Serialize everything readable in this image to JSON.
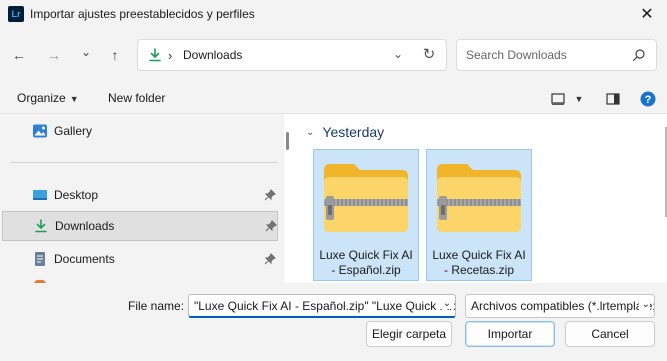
{
  "window": {
    "app_icon_text": "Lr",
    "title": "Importar ajustes preestablecidos y perfiles",
    "close_glyph": "✕"
  },
  "nav": {
    "back_glyph": "←",
    "forward_glyph": "→",
    "recent_glyph": "⌄",
    "up_glyph": "↑",
    "address_separator": "›",
    "address_location": "Downloads",
    "address_dropdown_glyph": "⌄",
    "refresh_glyph": "↻",
    "search_placeholder": "Search Downloads"
  },
  "toolbar": {
    "organize_label": "Organize",
    "organize_caret": "▼",
    "new_folder_label": "New folder"
  },
  "sidebar": {
    "items": [
      {
        "label": "Gallery",
        "icon": "gallery-icon"
      },
      {
        "label": "Desktop",
        "icon": "desktop-icon",
        "pinned": true
      },
      {
        "label": "Downloads",
        "icon": "download-icon",
        "pinned": true,
        "selected": true
      },
      {
        "label": "Documents",
        "icon": "documents-icon",
        "pinned": true
      }
    ]
  },
  "files": {
    "group_label": "Yesterday",
    "group_chevron": "⌄",
    "items": [
      {
        "name": "Luxe Quick Fix AI - Español.zip",
        "icon": "zip-folder-icon",
        "selected": true
      },
      {
        "name": "Luxe Quick Fix AI - Recetas.zip",
        "icon": "zip-folder-icon",
        "selected": true
      }
    ]
  },
  "bottom": {
    "file_name_label": "File name:",
    "file_name_value": "\"Luxe Quick Fix AI - Español.zip\" \"Luxe Quick Fix AI - Recetas.zip\"",
    "file_name_dropdown_glyph": "⌄",
    "file_type_value": "Archivos compatibles (*.lrtemplate;*.xmp;*.zip)",
    "file_type_chevron": "⌄",
    "choose_folder_label": "Elegir carpeta",
    "import_label": "Importar",
    "cancel_label": "Cancel"
  },
  "colors": {
    "accent": "#005fb8",
    "selection_bg": "#cce4f7",
    "selection_border": "#99c9ef",
    "folder_yellow": "#f8c84a",
    "download_green": "#1e9e5a"
  }
}
